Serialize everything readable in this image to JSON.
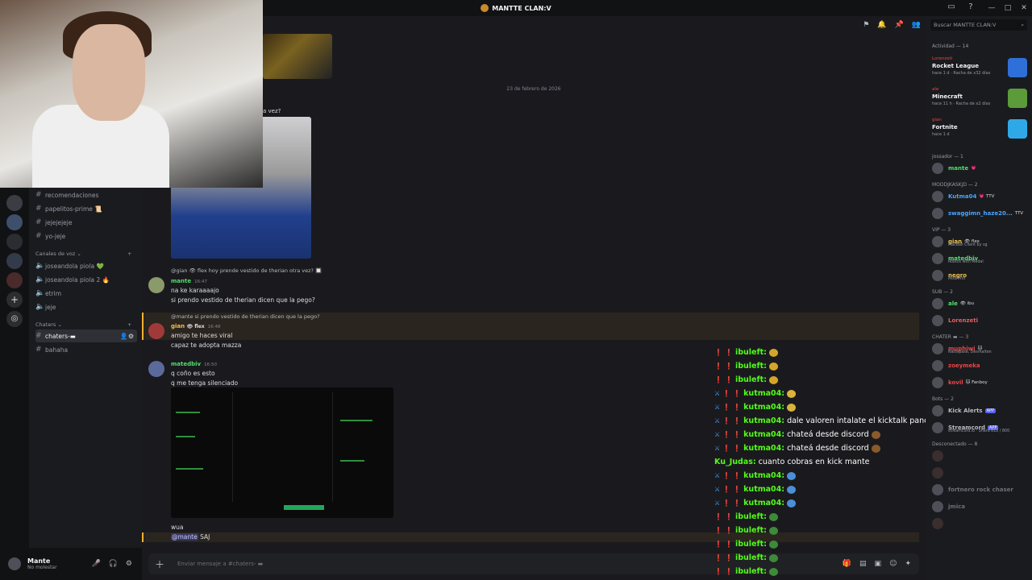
{
  "window": {
    "title": "MANTTE CLAN:V"
  },
  "channels": {
    "text": [
      {
        "label": "recomendaciones"
      },
      {
        "label": "papelitos-prime 📜"
      },
      {
        "label": "jejejejeje"
      },
      {
        "label": "yo-jeje"
      }
    ],
    "voice_category": "Canales de voz",
    "voice": [
      {
        "label": "joseandola piola 💚"
      },
      {
        "label": "joseandola piola 2 🔥"
      },
      {
        "label": "etrim"
      },
      {
        "label": "jeje"
      }
    ],
    "chat_category": "Chaters",
    "chat": [
      {
        "label": "chaters-▬",
        "active": true
      },
      {
        "label": "bahaha"
      }
    ]
  },
  "user": {
    "name": "Mante",
    "status": "No molestar"
  },
  "chat": {
    "date_divider": "23 de febrero de 2026",
    "fragment": "a vez?",
    "messages": [
      {
        "reply": "@gian 👁 flex  hoy prende vestido de therian otra vez? 🔲",
        "author": "mante",
        "author_color": "#4ee06b",
        "time": "16:47",
        "lines": [
          "na ke karaaaajo",
          "si prendo vestido de therian dicen que la pego?"
        ]
      },
      {
        "reply": "@mante si prendo vestido de therian dicen que la pego?",
        "author": "gian",
        "author_color": "#f0c04e",
        "badge": "👁 flex",
        "time": "16:48",
        "lines": [
          "amigo te haces viral",
          "capaz te adopta mazza"
        ]
      },
      {
        "author": "matedbiv",
        "author_color": "#4ee06b",
        "time": "16:50",
        "lines": [
          "q coño es esto",
          "q me tenga silenciado"
        ]
      },
      {
        "lines": [
          "wua"
        ],
        "mention_line": {
          "mention": "@mante",
          "text": " SAJ"
        }
      }
    ],
    "input_placeholder": "Enviar mensaje a #chaters- ▬"
  },
  "stream_chat": [
    {
      "badges": [
        "b1",
        "b2"
      ],
      "user": "ibuleft:",
      "text": "",
      "emote": "#d4a52a",
      "color": "#53fc18"
    },
    {
      "badges": [
        "b1",
        "b2"
      ],
      "user": "ibuleft:",
      "text": "",
      "emote": "#d4a52a",
      "color": "#53fc18"
    },
    {
      "badges": [
        "b1",
        "b2"
      ],
      "user": "ibuleft:",
      "text": "",
      "emote": "#d4a52a",
      "color": "#53fc18"
    },
    {
      "badges": [
        "b3",
        "b1",
        "b2"
      ],
      "user": "kutma04:",
      "text": "",
      "emote": "#d9b43c",
      "color": "#53fc18"
    },
    {
      "badges": [
        "b3",
        "b1",
        "b2"
      ],
      "user": "kutma04:",
      "text": "",
      "emote": "#d9b43c",
      "color": "#53fc18"
    },
    {
      "badges": [
        "b3",
        "b1",
        "b2"
      ],
      "user": "kutma04:",
      "text": "dale valoren intalate el kicktalk pancho",
      "emote": "",
      "color": "#53fc18"
    },
    {
      "badges": [
        "b3",
        "b1",
        "b2"
      ],
      "user": "kutma04:",
      "text": "chateá desde discord",
      "emote": "#8a5a2b",
      "color": "#53fc18"
    },
    {
      "badges": [
        "b3",
        "b1",
        "b2"
      ],
      "user": "kutma04:",
      "text": "chateá desde discord",
      "emote": "#8a5a2b",
      "color": "#53fc18"
    },
    {
      "badges": [],
      "user": "Ku_Judas:",
      "text": "cuanto cobras en kick mante",
      "emote": "",
      "color": "#53fc18"
    },
    {
      "badges": [
        "b3",
        "b1",
        "b2"
      ],
      "user": "kutma04:",
      "text": "",
      "emote": "#4a8fd8",
      "color": "#53fc18"
    },
    {
      "badges": [
        "b3",
        "b1",
        "b2"
      ],
      "user": "kutma04:",
      "text": "",
      "emote": "#4a8fd8",
      "color": "#53fc18"
    },
    {
      "badges": [
        "b3",
        "b1",
        "b2"
      ],
      "user": "kutma04:",
      "text": "",
      "emote": "#4a8fd8",
      "color": "#53fc18"
    },
    {
      "badges": [
        "b1",
        "b2"
      ],
      "user": "ibuleft:",
      "text": "",
      "emote": "#3d8a3a",
      "color": "#53fc18"
    },
    {
      "badges": [
        "b1",
        "b2"
      ],
      "user": "ibuleft:",
      "text": "",
      "emote": "#3d8a3a",
      "color": "#53fc18"
    },
    {
      "badges": [
        "b1",
        "b2"
      ],
      "user": "ibuleft:",
      "text": "",
      "emote": "#3d8a3a",
      "color": "#53fc18"
    },
    {
      "badges": [
        "b1",
        "b2"
      ],
      "user": "ibuleft:",
      "text": "",
      "emote": "#3d8a3a",
      "color": "#53fc18"
    },
    {
      "badges": [
        "b1",
        "b2"
      ],
      "user": "ibuleft:",
      "text": "",
      "emote": "#3d8a3a",
      "color": "#53fc18"
    }
  ],
  "members": {
    "search_placeholder": "Buscar MANTTE CLAN:V",
    "activity_header": "Actividad — 14",
    "activities": [
      {
        "user": "Lorenzeti",
        "game": "Rocket League",
        "detail": "hace 1 d  ·  Racha de x32 días",
        "color": "#2f6fd8"
      },
      {
        "user": "ale",
        "game": "Minecraft",
        "detail": "hace 11 h  ·  Racha de x2 días",
        "color": "#5c9b3a"
      },
      {
        "user": "gian",
        "game": "Fortnite",
        "detail": "hace 1 d",
        "color": "#2fa8e8"
      }
    ],
    "groups": [
      {
        "header": "jossador — 1",
        "members": [
          {
            "name": "mante",
            "color": "#4ee06b",
            "tag": "💗",
            "sub": ""
          }
        ]
      },
      {
        "header": "MODDJKASKJD — 2",
        "members": [
          {
            "name": "Kutma04",
            "color": "#4aa3ff",
            "tag": "💗 TTV",
            "sub": ""
          },
          {
            "name": "swaggimn_haze20...",
            "color": "#4aa3ff",
            "tag": "TTV",
            "sub": ""
          }
        ]
      },
      {
        "header": "VIP — 3",
        "members": [
          {
            "name": "gian",
            "color": "#f0c04e",
            "tag": "👁 flex",
            "sub": "MacBall Client by sg"
          },
          {
            "name": "matedbiv",
            "color": "#4ee06b",
            "tag": "",
            "sub": "Roblox with Medal"
          },
          {
            "name": "negro",
            "color": "#f0c04e",
            "tag": "",
            "sub": "Modrinth"
          }
        ]
      },
      {
        "header": "SUB — 2",
        "members": [
          {
            "name": "ale",
            "color": "#4ee06b",
            "tag": "👁 ibu",
            "sub": ""
          },
          {
            "name": "Lorenzeti",
            "color": "#e06060",
            "tag": "",
            "sub": ""
          }
        ]
      },
      {
        "header": "CHATER ▬ — 3",
        "members": [
          {
            "name": "muphiwi",
            "color": "#ed4245",
            "tag": "🐱",
            "sub": "Nattepasé, Desmalten"
          },
          {
            "name": "zoeymeka",
            "color": "#ed4245",
            "tag": "",
            "sub": ""
          },
          {
            "name": "kovil",
            "color": "#ed4245",
            "tag": "🐱 Fanboy",
            "sub": ""
          }
        ]
      },
      {
        "header": "Bots — 2",
        "members": [
          {
            "name": "Kick Alerts",
            "color": "#b5bac1",
            "tag": "APP",
            "sub": ""
          },
          {
            "name": "Streamcord",
            "color": "#b5bac1",
            "tag": "APP",
            "sub": "streamcord.io · Shard 812 / 800"
          }
        ]
      },
      {
        "header": "Desconectado — 8",
        "members": [
          {
            "name": "",
            "color": "#5c3a3a",
            "tag": "",
            "sub": ""
          },
          {
            "name": "",
            "color": "#5c3a3a",
            "tag": "",
            "sub": ""
          },
          {
            "name": "fortnero rock chaser",
            "color": "#6b6f78",
            "tag": "",
            "sub": ""
          },
          {
            "name": "jmica",
            "color": "#6b6f78",
            "tag": "",
            "sub": ""
          },
          {
            "name": "",
            "color": "#6b6f78",
            "tag": "",
            "sub": ""
          }
        ]
      }
    ]
  }
}
